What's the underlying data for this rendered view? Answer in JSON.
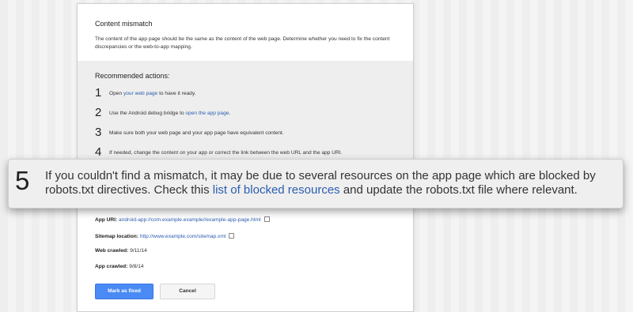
{
  "dialog": {
    "title": "Content mismatch",
    "description": "The content of the app page should be the same as the content of the web page. Determine whether you need to fix the content discrepancies or the web-to-app mapping.",
    "recommended_title": "Recommended actions:",
    "steps": [
      {
        "num": "1",
        "pre": "Open ",
        "link": "your web page",
        "post": " to have it ready."
      },
      {
        "num": "2",
        "pre": "Use the Android debug bridge to ",
        "link": "open the app page",
        "post": "."
      },
      {
        "num": "3",
        "text": "Make sure both your web page and your app page have equivalent content."
      },
      {
        "num": "4",
        "text": "If needed, change the content on your app or correct the link between the web URL and the app URI."
      }
    ],
    "fields": {
      "app_uri_label": "App URI:",
      "app_uri_value": "android-app://com.example.example//example-app-page.html",
      "sitemap_label": "Sitemap location:",
      "sitemap_value": "http://www.example.com/sitemap.xml",
      "web_crawled_label": "Web crawled:",
      "web_crawled_value": "9/11/14",
      "app_crawled_label": "App crawled:",
      "app_crawled_value": "9/8/14"
    },
    "buttons": {
      "primary": "Mark as fixed",
      "secondary": "Cancel"
    }
  },
  "callout": {
    "num": "5",
    "pre": "If you couldn't find a mismatch, it may be due to several resources on the app page which are blocked by robots.txt directives. Check this ",
    "link": "list of blocked resources",
    "post": " and update the robots.txt file where relevant."
  },
  "colors": {
    "link": "#2a5db0",
    "primary_button": "#4a8af4",
    "callout_bg": "#efefef"
  }
}
